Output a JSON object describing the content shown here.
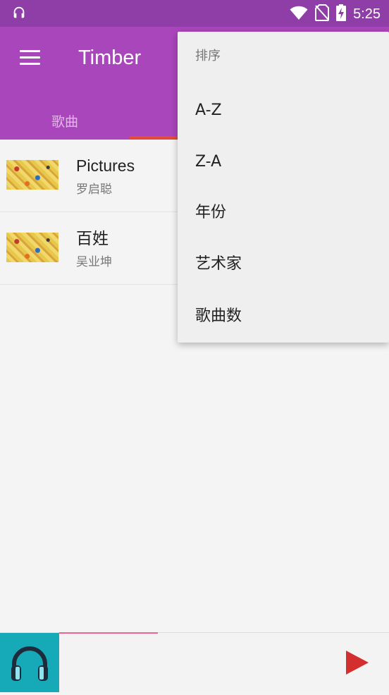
{
  "status_bar": {
    "time": "5:25",
    "icons": [
      "headphones-icon",
      "wifi-icon",
      "no-sim-icon",
      "battery-charging-icon"
    ]
  },
  "app_bar": {
    "title": "Timber",
    "menu_icon": "hamburger-menu-icon",
    "tabs": [
      {
        "label": "歌曲"
      }
    ],
    "accent_color": "#aa46bb",
    "indicator_color": "#e64a3c"
  },
  "songs": [
    {
      "title": "Pictures",
      "artist": "罗启聪"
    },
    {
      "title": "百姓",
      "artist": "吴业坤"
    }
  ],
  "sort_menu": {
    "header": "排序",
    "items": [
      {
        "label": "A-Z"
      },
      {
        "label": "Z-A"
      },
      {
        "label": "年份"
      },
      {
        "label": "艺术家"
      },
      {
        "label": "歌曲数"
      }
    ]
  },
  "mini_player": {
    "art_icon": "headphones-icon",
    "play_icon": "play-icon",
    "progress": 0.3,
    "progress_color": "#f06292",
    "play_color": "#d32f2f"
  }
}
